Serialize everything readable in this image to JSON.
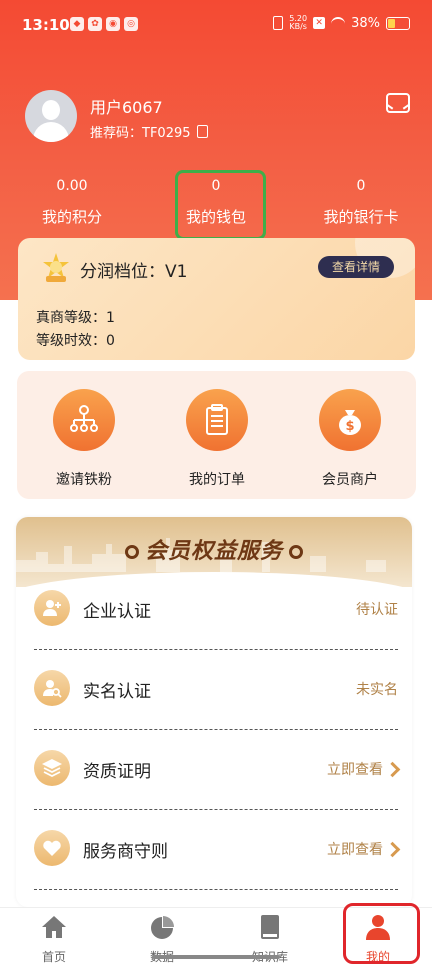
{
  "status_bar": {
    "time": "13:10",
    "net_speed_top": "5.20",
    "net_speed_unit": "KB/s",
    "battery": "38%"
  },
  "profile": {
    "username": "用户6067",
    "referral": "推荐码：TF0295"
  },
  "stats": [
    {
      "value": "0.00",
      "label": "我的积分"
    },
    {
      "value": "0",
      "label": "我的钱包"
    },
    {
      "value": "0",
      "label": "我的银行卡"
    }
  ],
  "tier": {
    "title": "分润档位：V1",
    "detail_button": "查看详情",
    "level_line": "真商等级：1",
    "validity_line": "等级时效：0"
  },
  "quick_actions": [
    {
      "label": "邀请铁粉",
      "icon": "org-chart-icon"
    },
    {
      "label": "我的订单",
      "icon": "clipboard-icon"
    },
    {
      "label": "会员商户",
      "icon": "money-bag-icon"
    }
  ],
  "service": {
    "title": "会员权益服务",
    "rows": [
      {
        "title": "企业认证",
        "status": "待认证",
        "icon": "add-user-icon",
        "chevron": false
      },
      {
        "title": "实名认证",
        "status": "未实名",
        "icon": "user-search-icon",
        "chevron": false
      },
      {
        "title": "资质证明",
        "status": "立即查看",
        "icon": "layers-icon",
        "chevron": true
      },
      {
        "title": "服务商守则",
        "status": "立即查看",
        "icon": "heart-icon",
        "chevron": true
      }
    ]
  },
  "tabs": [
    {
      "label": "首页",
      "icon": "home-icon"
    },
    {
      "label": "数据",
      "icon": "pie-chart-icon"
    },
    {
      "label": "知识库",
      "icon": "book-icon"
    },
    {
      "label": "我的",
      "icon": "user-icon"
    }
  ],
  "colors": {
    "header": "#f44a33",
    "accent_gold": "#b08248",
    "active_tab": "#e8452d",
    "highlight_green": "#3eae49",
    "highlight_red": "#e0262b"
  }
}
